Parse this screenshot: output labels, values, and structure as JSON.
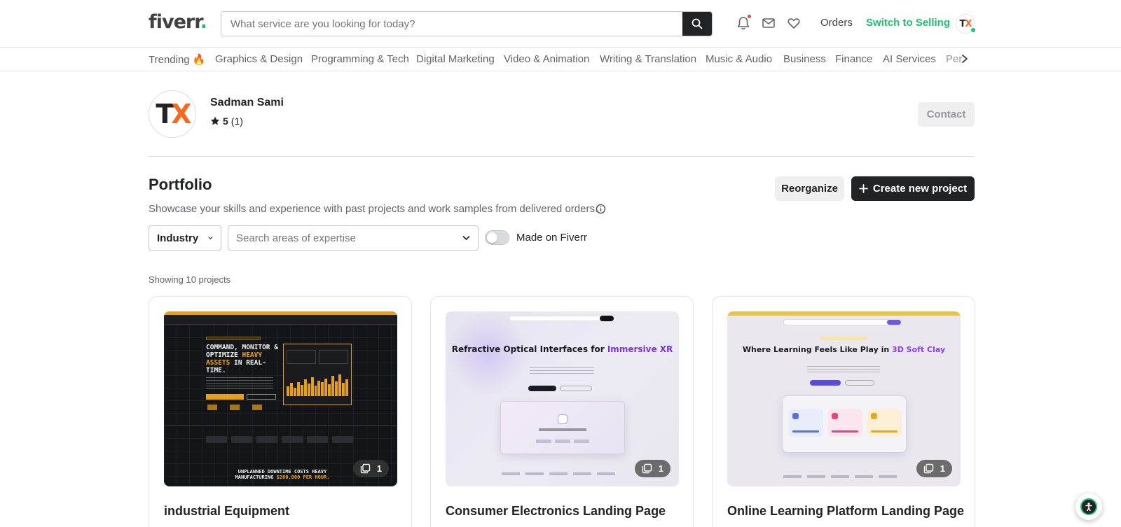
{
  "header": {
    "logo_text": "fiverr",
    "logo_dot": ".",
    "search_placeholder": "What service are you looking for today?",
    "orders_label": "Orders",
    "switch_label": "Switch to Selling",
    "avatar_t": "T",
    "avatar_x": "X",
    "icons": [
      "search-icon",
      "bell-icon",
      "mail-icon",
      "heart-icon"
    ]
  },
  "categories": [
    "Trending 🔥",
    "Graphics & Design",
    "Programming & Tech",
    "Digital Marketing",
    "Video & Animation",
    "Writing & Translation",
    "Music & Audio",
    "Business",
    "Finance",
    "AI Services",
    "Per"
  ],
  "profile": {
    "avatar_t": "T",
    "avatar_x": "X",
    "name": "Sadman Sami",
    "rating_score": "5",
    "rating_count": "(1)",
    "contact_label": "Contact"
  },
  "portfolio": {
    "title": "Portfolio",
    "subtitle": "Showcase your skills and experience with past projects and work samples from delivered orders.",
    "reorganize_label": "Reorganize",
    "create_label": "Create new project",
    "industry_label": "Industry",
    "expertise_placeholder": "Search areas of expertise",
    "toggle_label": "Made on Fiverr",
    "toggle_on": false,
    "showing_text": "Showing 10 projects"
  },
  "projects": [
    {
      "title": "industrial Equipment",
      "count": "1",
      "thumb": {
        "headline_a": "COMMAND, MONITOR & OPTIMIZE ",
        "headline_b": "HEAVY ASSETS",
        "headline_c": " IN REAL-TIME.",
        "footer_a": "UNPLANNED DOWNTIME COSTS HEAVY MANUFACTURING ",
        "footer_b": "$260,000 PER HOUR."
      }
    },
    {
      "title": "Consumer Electronics Landing Page",
      "count": "1",
      "thumb": {
        "headline_a": "Refractive Optical Interfaces for ",
        "headline_b": "Immersive XR"
      }
    },
    {
      "title": "Online Learning Platform Landing Page",
      "count": "1",
      "thumb": {
        "headline_a": "Where Learning Feels Like Play in ",
        "headline_b": "3D Soft Clay"
      }
    }
  ],
  "colors": {
    "brand_green": "#1dbf73",
    "dark": "#222325",
    "accent_orange": "#f26b21"
  }
}
